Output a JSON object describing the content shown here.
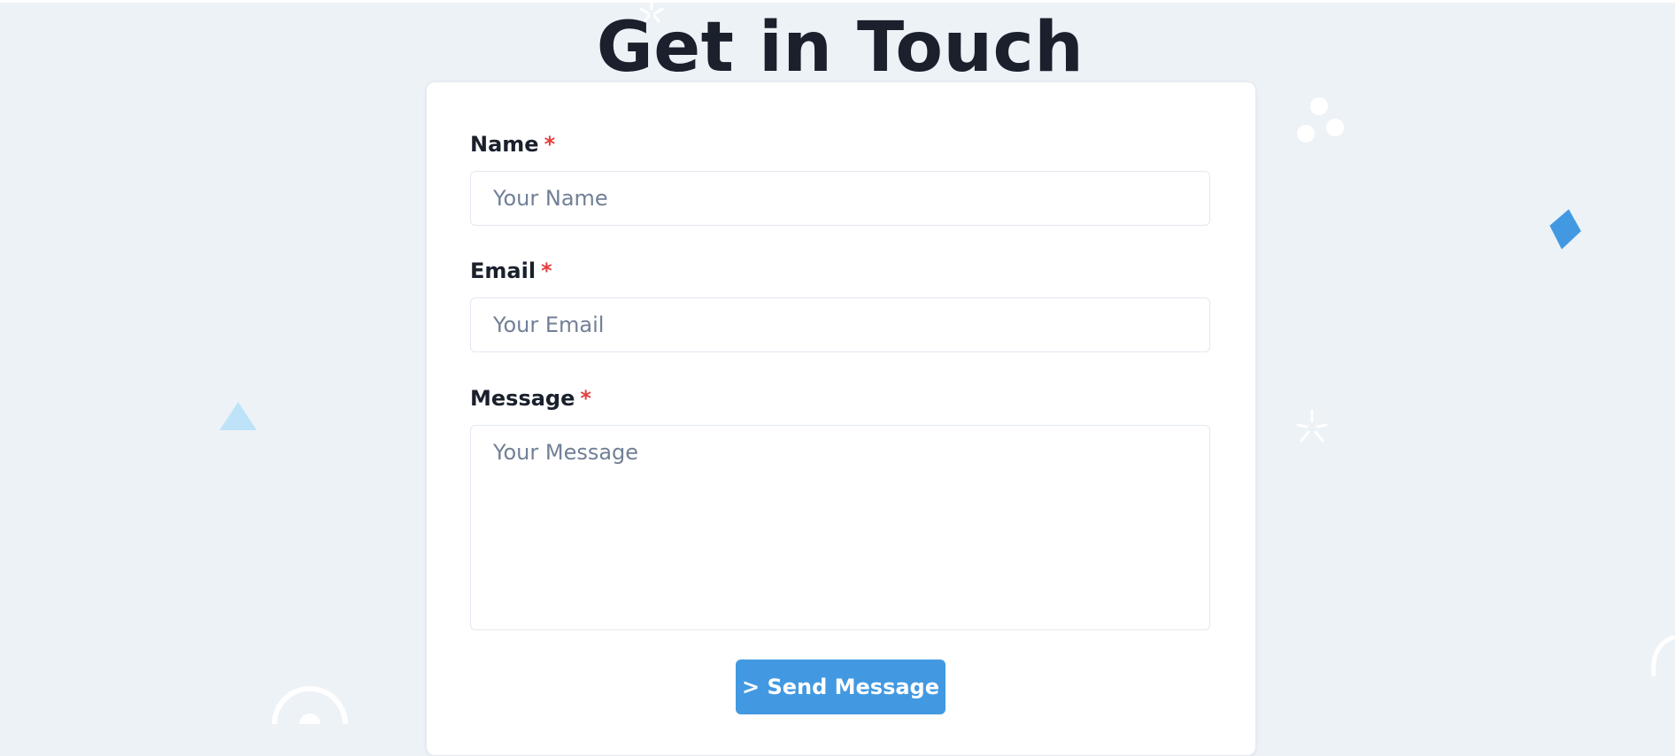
{
  "page": {
    "title": "Get in Touch"
  },
  "form": {
    "required_marker": "*",
    "name": {
      "label": "Name",
      "placeholder": "Your Name",
      "value": ""
    },
    "email": {
      "label": "Email",
      "placeholder": "Your Email",
      "value": ""
    },
    "message": {
      "label": "Message",
      "placeholder": "Your Message",
      "value": ""
    },
    "submit_label": "> Send Message"
  },
  "colors": {
    "background": "#edf2f7",
    "card": "#ffffff",
    "title_text": "#1a202c",
    "required_marker": "#e53e3e",
    "button": "#4299e1",
    "decor_diamond": "#4299e1",
    "decor_triangle": "#bee3f8"
  }
}
